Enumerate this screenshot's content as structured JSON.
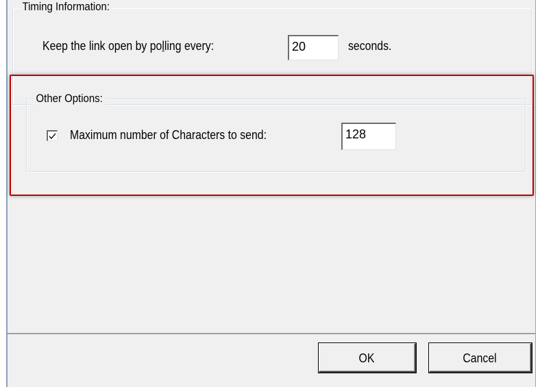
{
  "timing": {
    "group_title": "Timing Information:",
    "poll_label_before": "Keep the link open by po",
    "poll_label_underlined": "l",
    "poll_label_after": "ling every:",
    "poll_value": "20",
    "seconds_label": "seconds."
  },
  "other": {
    "group_title": "Other Options:",
    "max_chars_label": "Maximum number of Characters to send:",
    "max_chars_checked": true,
    "max_chars_value": "128"
  },
  "buttons": {
    "ok_label": "OK",
    "cancel_label": "Cancel"
  },
  "colors": {
    "highlight": "#c00000",
    "dialog_bg": "#f0f0f0"
  }
}
